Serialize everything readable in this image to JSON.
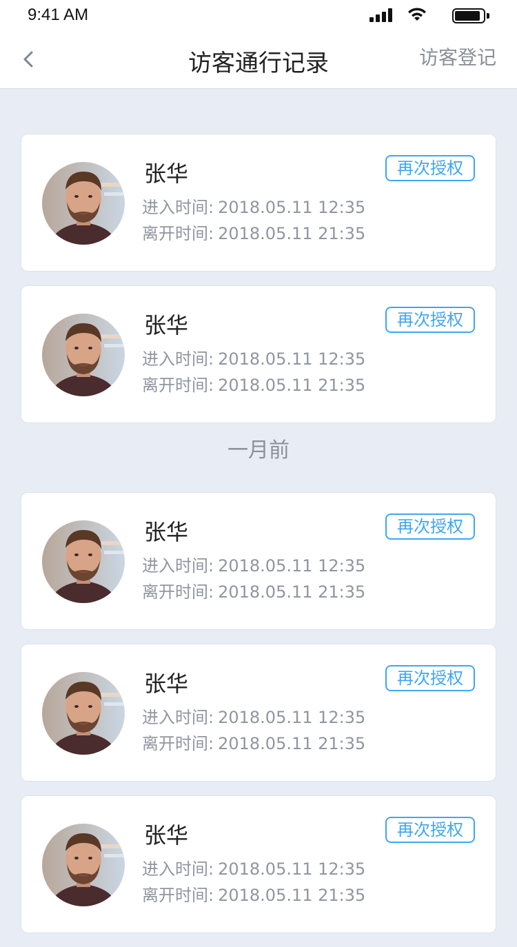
{
  "status_bar": {
    "time": "9:41 AM",
    "battery_level": 0.9
  },
  "nav": {
    "title": "访客通行记录",
    "action": "访客登记",
    "back_icon": "chevron-left-icon"
  },
  "colors": {
    "accent": "#3fa6f0",
    "background": "#e8edf5",
    "muted_text": "#9095a0"
  },
  "groups": [
    {
      "label": "",
      "records": [
        {
          "name": "张华",
          "enter_label": "进入时间:",
          "enter_time": "2018.05.11 12:35",
          "leave_label": "离开时间:",
          "leave_time": "2018.05.11 21:35",
          "action": "再次授权"
        },
        {
          "name": "张华",
          "enter_label": "进入时间:",
          "enter_time": "2018.05.11 12:35",
          "leave_label": "离开时间:",
          "leave_time": "2018.05.11 21:35",
          "action": "再次授权"
        }
      ]
    },
    {
      "label": "一月前",
      "records": [
        {
          "name": "张华",
          "enter_label": "进入时间:",
          "enter_time": "2018.05.11 12:35",
          "leave_label": "离开时间:",
          "leave_time": "2018.05.11 21:35",
          "action": "再次授权"
        },
        {
          "name": "张华",
          "enter_label": "进入时间:",
          "enter_time": "2018.05.11 12:35",
          "leave_label": "离开时间:",
          "leave_time": "2018.05.11 21:35",
          "action": "再次授权"
        },
        {
          "name": "张华",
          "enter_label": "进入时间:",
          "enter_time": "2018.05.11 12:35",
          "leave_label": "离开时间:",
          "leave_time": "2018.05.11 21:35",
          "action": "再次授权"
        }
      ]
    }
  ]
}
